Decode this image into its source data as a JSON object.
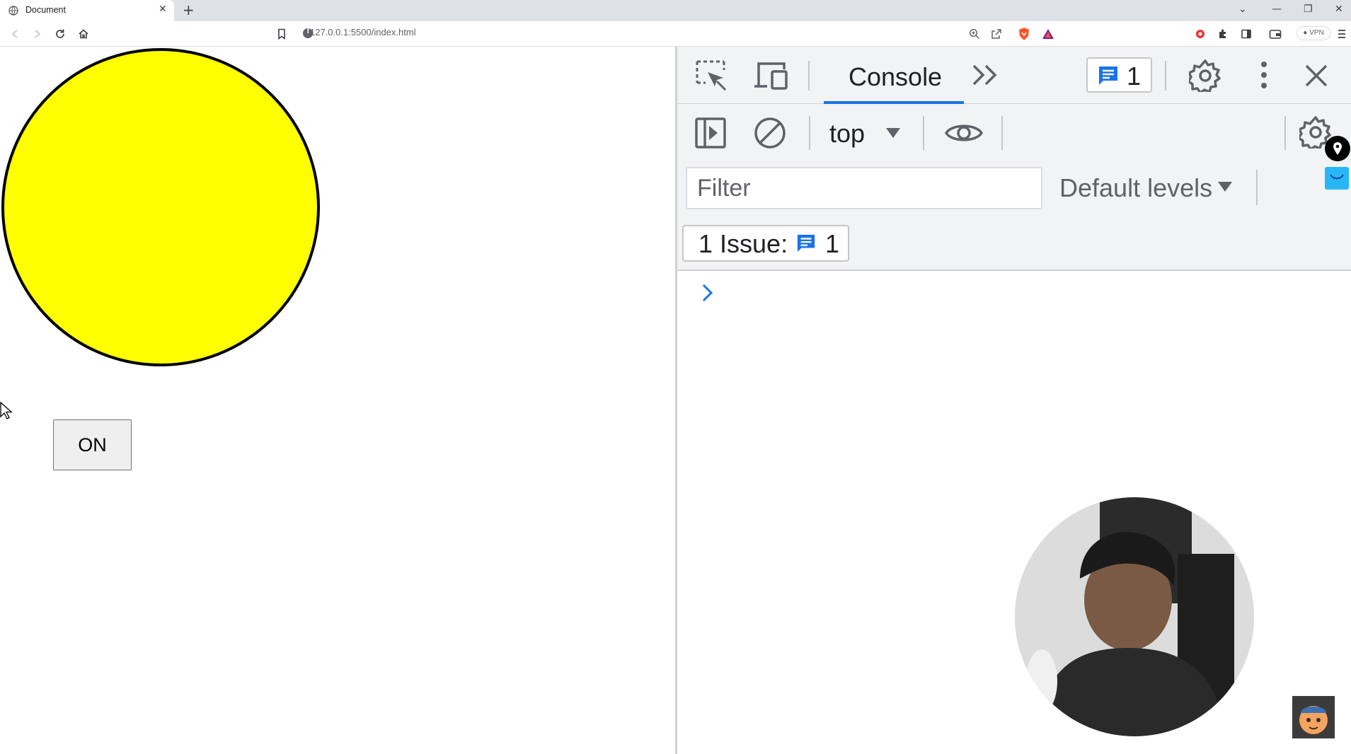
{
  "browser": {
    "tab_title": "Document",
    "tab_close": "✕",
    "new_tab": "+",
    "url": "127.0.0.1:5500/index.html",
    "vpn_label": "● VPN",
    "window_controls": [
      "⌄",
      "—",
      "❐",
      "✕"
    ]
  },
  "page": {
    "button_label": "ON",
    "circle_color": "#ffff00"
  },
  "devtools": {
    "active_tab": "Console",
    "issues_badge_count": "1",
    "context": "top",
    "filter_placeholder": "Filter",
    "levels_label": "Default levels",
    "issues_label": "1 Issue:",
    "issues_count": "1"
  },
  "colors": {
    "accent_blue": "#1a73e8",
    "brave_orange": "#fb542b"
  }
}
